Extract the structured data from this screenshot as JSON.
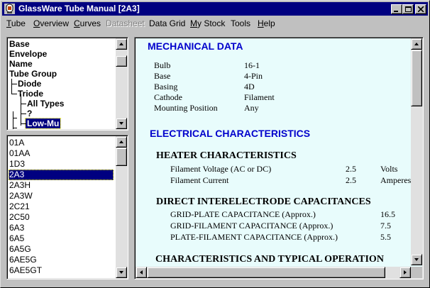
{
  "window": {
    "title": "GlassWare Tube Manual  [2A3]",
    "accent_color": "#000080"
  },
  "menu": [
    {
      "label": "Tube",
      "accel": "T",
      "rest": "ube",
      "enabled": true
    },
    {
      "label": "Overview",
      "accel": "O",
      "rest": "verview",
      "enabled": true
    },
    {
      "label": "Curves",
      "accel": "C",
      "rest": "urves",
      "enabled": true
    },
    {
      "label": "Datasheet",
      "accel": "",
      "rest": "Datasheet",
      "enabled": false
    },
    {
      "label": "Data Grid",
      "accel": "",
      "rest": "Data Grid",
      "enabled": true
    },
    {
      "label": "My Stock",
      "accel": "M",
      "rest": "y Stock",
      "enabled": true
    },
    {
      "label": "Tools",
      "accel": "",
      "rest": "Tools",
      "enabled": true
    },
    {
      "label": "Help",
      "accel": "H",
      "rest": "elp",
      "enabled": true
    }
  ],
  "tree": {
    "items": [
      "Base",
      "Envelope",
      "Name",
      "Tube Group",
      "Diode",
      "Triode",
      "All Types",
      "?",
      "Low-Mu"
    ],
    "selected": "Low-Mu"
  },
  "tube_list": {
    "items": [
      "01A",
      "01AA",
      "1D3",
      "2A3",
      "2A3H",
      "2A3W",
      "2C21",
      "2C50",
      "6A3",
      "6A5",
      "6A5G",
      "6AE5G",
      "6AE5GT"
    ],
    "selected": "2A3"
  },
  "datasheet": {
    "mechanical_title": "MECHANICAL DATA",
    "mechanical": [
      {
        "label": "Bulb",
        "value": "16-1"
      },
      {
        "label": "Base",
        "value": "4-Pin"
      },
      {
        "label": "Basing",
        "value": "4D"
      },
      {
        "label": "Cathode",
        "value": "Filament"
      },
      {
        "label": "Mounting Position",
        "value": "Any"
      }
    ],
    "electrical_title": "ELECTRICAL  CHARACTERISTICS",
    "heater_title": "HEATER CHARACTERISTICS",
    "heater": [
      {
        "label": "Filament Voltage (AC or DC)",
        "value": "2.5",
        "unit": "Volts"
      },
      {
        "label": "Filament Current",
        "value": "2.5",
        "unit": "Amperes"
      }
    ],
    "capacitance_title": "DIRECT INTERELECTRODE CAPACITANCES",
    "capacitance": [
      {
        "label": "GRID-PLATE CAPACITANCE (Approx.)",
        "value": "16.5"
      },
      {
        "label": "GRID-FILAMENT CAPACITANCE (Approx.)",
        "value": "7.5"
      },
      {
        "label": "PLATE-FILAMENT CAPACITANCE (Approx.)",
        "value": "5.5"
      }
    ],
    "typical_title": "CHARACTERISTICS AND TYPICAL OPERATION"
  }
}
